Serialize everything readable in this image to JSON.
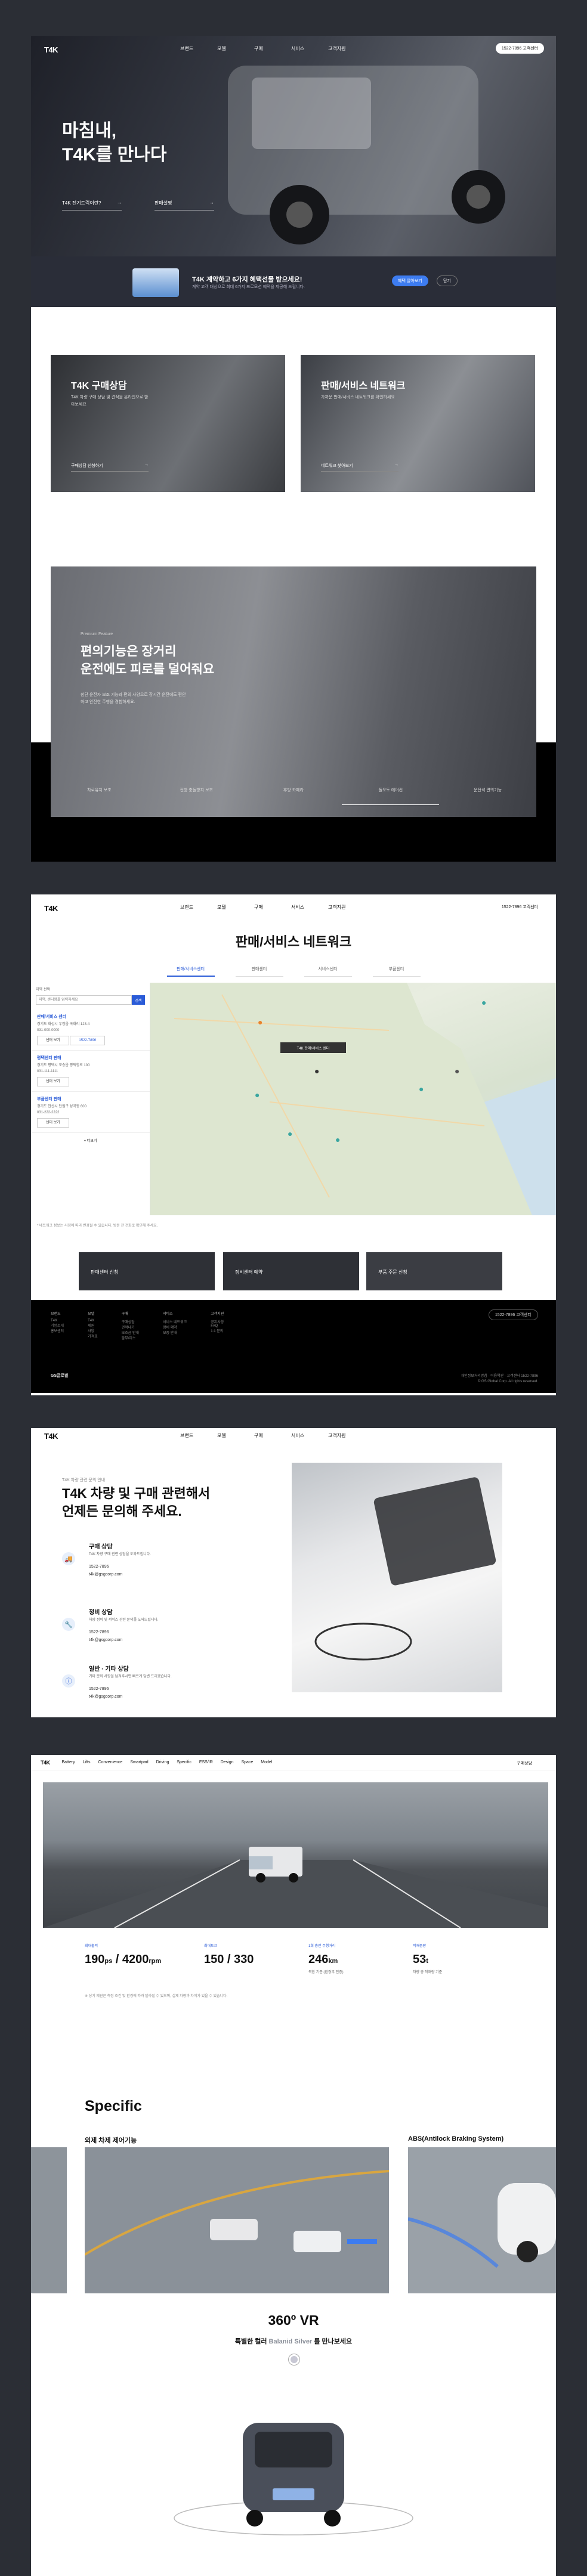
{
  "nav": {
    "logo": "T4K",
    "menu": [
      "브랜드",
      "모델",
      "구매",
      "서비스",
      "고객지원"
    ],
    "cs_label": "1522-7896 고객센터"
  },
  "hero": {
    "title_line1": "마침내,",
    "title_logo": "T4K",
    "title_line2": "를 만나다",
    "link1": "T4K 전기트럭이란?",
    "link2": "판매설명",
    "promo_title": "T4K 계약하고 6가지 혜택선물 받으세요!",
    "promo_sub": "계약 고객 대상으로 최대 6가지 프로모션 혜택을 제공해 드립니다.",
    "promo_btn": "혜택 알아보기",
    "promo_btn2": "닫기"
  },
  "cards": [
    {
      "title": "T4K 구매상담",
      "desc": "T4K 차량 구매 상담 및 견적을 온라인으로 받아보세요",
      "link": "구매상담 신청하기"
    },
    {
      "title": "판매/서비스 네트워크",
      "desc": "가까운 판매/서비스 네트워크를 확인하세요",
      "link": "네트워크 찾아보기"
    }
  ],
  "feature": {
    "tag": "Premium Feature",
    "title_line1": "편의기능은 장거리",
    "title_line2": "운전에도 피로를 덜어줘요",
    "desc": "첨단 운전자 보조 기능과 편의 사양으로 장시간 운전에도 편안하고 안전한 주행을 경험하세요.",
    "tabs": [
      "차로유지 보조",
      "전방 충돌방지 보조",
      "후방 카메라",
      "풀오토 에어컨",
      "운전석 편의기능"
    ]
  },
  "network": {
    "title": "판매/서비스 네트워크",
    "tabs": [
      "판매/서비스센터",
      "판매센터",
      "서비스센터",
      "부품센터"
    ],
    "search_label": "지역 선택",
    "search_placeholder": "지역, 센터명을 입력하세요",
    "search_btn": "검색",
    "dealers": [
      {
        "name": "판매/서비스 센터",
        "addr": "경기도 화성시 우정읍 국화리 123-4",
        "tel": "031-000-0000",
        "btn1": "센터 보기",
        "btn2": "1522-7896"
      },
      {
        "name": "평택센터 판매",
        "addr": "경기도 평택시 포승읍 평택항로 100",
        "tel": "031-111-1111",
        "btn1": "센터 보기"
      },
      {
        "name": "부품센터 판매",
        "addr": "경기도 안산시 단원구 성곡동 600",
        "tel": "031-222-2222",
        "btn1": "센터 보기"
      }
    ],
    "more": "+ 더보기",
    "map_popup": "T4K 판매/서비스 센터",
    "notice": "* 네트워크 정보는 사정에 따라 변경될 수 있습니다. 방문 전 전화로 확인해 주세요.",
    "services": [
      "판매센터 신청",
      "정비센터 예약",
      "부품 주문 신청"
    ]
  },
  "footer": {
    "cols": [
      {
        "head": "브랜드",
        "items": [
          "T4K",
          "기업소개",
          "홍보센터"
        ]
      },
      {
        "head": "모델",
        "items": [
          "T4K",
          "제원",
          "사양",
          "가격표"
        ]
      },
      {
        "head": "구매",
        "items": [
          "구매상담",
          "견적내기",
          "보조금 안내",
          "할부/리스"
        ]
      },
      {
        "head": "서비스",
        "items": [
          "서비스 네트워크",
          "정비 예약",
          "보증 안내"
        ]
      },
      {
        "head": "고객지원",
        "items": [
          "공지사항",
          "FAQ",
          "1:1 문의"
        ]
      }
    ],
    "cs_label": "1522-7896 고객센터",
    "brand": "GS글로벌",
    "links": "개인정보처리방침 · 이용약관 · 고객센터 1522-7896",
    "copyright": "© GS Global Corp. All rights reserved."
  },
  "contact": {
    "kicker": "T4K 차량 관련 문의 안내",
    "title_line1": "T4K 차량 및 구매 관련해서",
    "title_line2": "언제든 문의해 주세요.",
    "items": [
      {
        "title": "구매 상담",
        "desc": "T4K 차량 구매 관련 상담을 도와드립니다.",
        "tel": "1522-7896",
        "email": "t4k@gsgcorp.com"
      },
      {
        "title": "정비 상담",
        "desc": "차량 정비 및 서비스 관련 문의를 도와드립니다.",
        "tel": "1522-7896",
        "email": "t4k@gsgcorp.com"
      },
      {
        "title": "일반 · 기타 상담",
        "desc": "기타 문의 사항을 남겨주시면 빠르게 답변 드리겠습니다.",
        "tel": "1522-7896",
        "email": "t4k@gsgcorp.com"
      }
    ]
  },
  "specs": {
    "nav": [
      "Battery",
      "Lifts",
      "Convenience",
      "Smartpad",
      "Driving",
      "Specific",
      "ESS/IR",
      "Design",
      "Space",
      "Model"
    ],
    "nav_right": "구매상담",
    "stats": [
      {
        "label": "최대출력",
        "value": "190",
        "unit_small": "ps",
        "value2": " / 4200",
        "unit2": "rpm",
        "sub": ""
      },
      {
        "label": "최대토크",
        "value": "150 / 330",
        "unit_small": "",
        "value2": "",
        "unit2": "",
        "sub": ""
      },
      {
        "label": "1회 충전 주행거리",
        "value": "246",
        "unit_small": "km",
        "value2": "",
        "unit2": "",
        "sub": "복합 기준 (환경부 인증)"
      },
      {
        "label": "적재중량",
        "value": "53",
        "unit_small": "t",
        "value2": "",
        "unit2": "",
        "sub": "차량 총 적재량 기준"
      }
    ],
    "footnote": "※ 상기 제원은 측정 조건 및 환경에 따라 달라질 수 있으며, 실제 차량과 차이가 있을 수 있습니다.",
    "specific_title": "Specific",
    "sub1": "외제 차제 제어기능",
    "sub2": "ABS(Antilock Braking System)",
    "vr_title": "360º VR",
    "vr_pre": "특별한 컬러 ",
    "vr_color": "Balanid Silver",
    "vr_post": " 를 만나보세요"
  }
}
